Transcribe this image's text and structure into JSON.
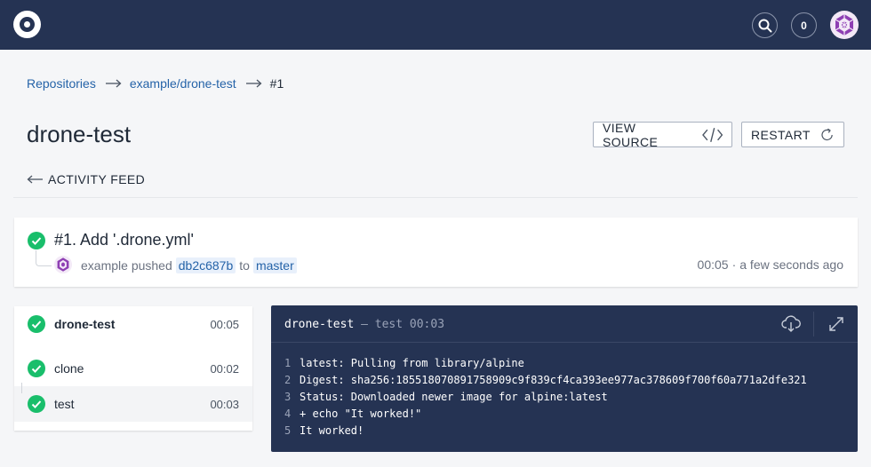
{
  "topbar": {
    "notification_count": "0"
  },
  "breadcrumb": {
    "root": "Repositories",
    "repo": "example/drone-test",
    "build": "#1"
  },
  "page": {
    "title": "drone-test",
    "view_source_label": "VIEW SOURCE",
    "restart_label": "RESTART",
    "activity_feed_label": "ACTIVITY FEED"
  },
  "build": {
    "title": "#1. Add '.drone.yml'",
    "author": "example",
    "action": "pushed",
    "commit": "db2c687b",
    "to_word": "to",
    "branch": "master",
    "duration": "00:05",
    "when": "a few seconds ago"
  },
  "steps": {
    "pipeline_name": "drone-test",
    "pipeline_time": "00:05",
    "items": [
      {
        "name": "clone",
        "time": "00:02"
      },
      {
        "name": "test",
        "time": "00:03"
      }
    ]
  },
  "log": {
    "title": "drone-test",
    "separator": " — ",
    "step": "test",
    "time": "00:03",
    "lines": [
      {
        "num": "1",
        "text": "latest: Pulling from library/alpine"
      },
      {
        "num": "2",
        "text": "Digest: sha256:185518070891758909c9f839cf4ca393ee977ac378609f700f60a771a2dfe321"
      },
      {
        "num": "3",
        "text": "Status: Downloaded newer image for alpine:latest"
      },
      {
        "num": "4",
        "text": "+ echo \"It worked!\""
      },
      {
        "num": "5",
        "text": "It worked!"
      }
    ]
  },
  "colors": {
    "navbar": "#253353",
    "success": "#19be6b",
    "link": "#2563a8"
  },
  "icons": [
    "drone-logo-icon",
    "search-icon",
    "user-avatar-icon",
    "arrow-right-icon",
    "code-icon",
    "refresh-icon",
    "arrow-left-icon",
    "check-circle-icon",
    "download-icon",
    "expand-icon"
  ]
}
